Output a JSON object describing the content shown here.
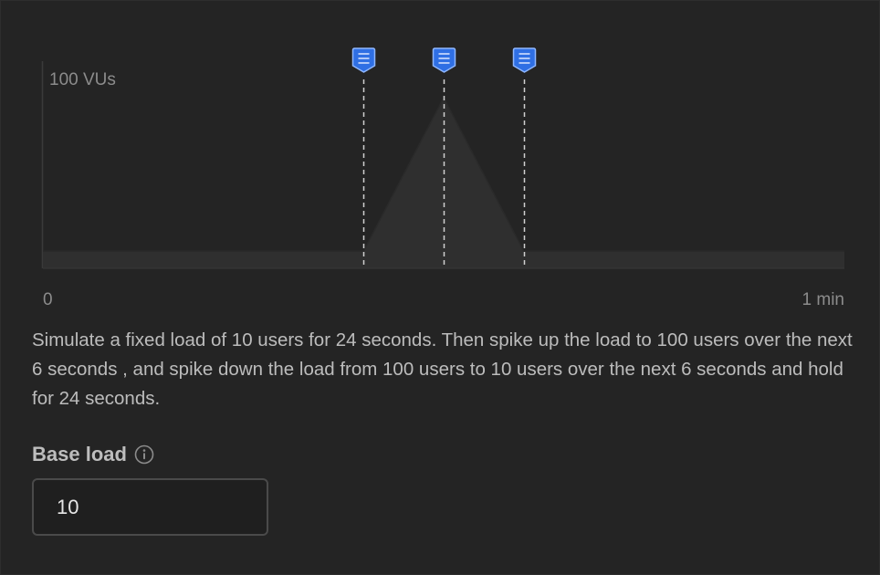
{
  "chart_data": {
    "type": "area",
    "x": [
      0,
      24,
      30,
      36,
      60
    ],
    "values": [
      10,
      10,
      100,
      10,
      10
    ],
    "markers_seconds": [
      24,
      30,
      36
    ],
    "ylim": [
      0,
      100
    ],
    "xlim": [
      0,
      60
    ],
    "y_max_label": "100 VUs",
    "x_start_label": "0",
    "x_end_label": "1 min"
  },
  "description": "Simulate a fixed load of 10 users for 24 seconds. Then spike up the load to 100 users over the next 6 seconds , and spike down the load from 100 users to 10 users over the next 6 seconds and hold for 24 seconds.",
  "base_load": {
    "label": "Base load",
    "value": "10",
    "info_icon": "info-circle-icon"
  },
  "colors": {
    "background": "#242424",
    "area_fill": "#2f2f2f",
    "marker_blue": "#2f6fe4",
    "marker_light": "#8fb7ff"
  }
}
